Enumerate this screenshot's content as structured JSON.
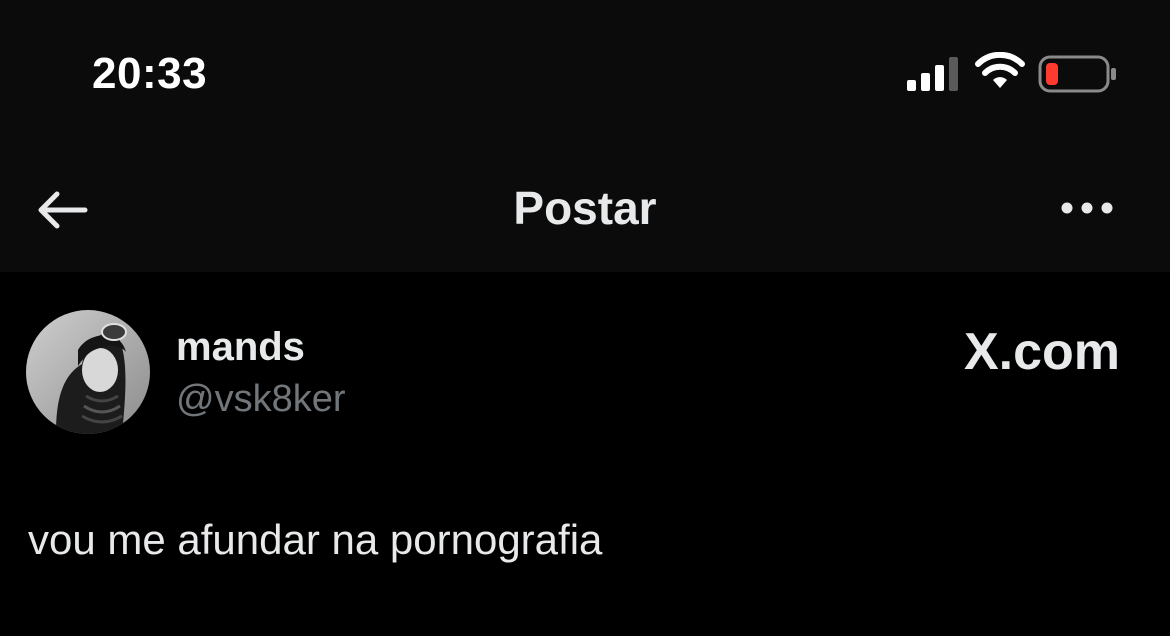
{
  "status_bar": {
    "time": "20:33",
    "icons": [
      "signal-icon",
      "wifi-icon",
      "battery-icon"
    ],
    "battery_color": "#ff3b30"
  },
  "nav": {
    "title": "Postar",
    "back_icon": "arrow-left-icon",
    "more_icon": "more-horizontal-icon"
  },
  "post": {
    "author_name": "mands",
    "author_handle": "@vsk8ker",
    "brand": "X.com",
    "text": "vou me afundar na pornografia"
  },
  "colors": {
    "background": "#000000",
    "header_background": "#0b0b0b",
    "primary_text": "#e7e9ea",
    "secondary_text": "#71767b"
  }
}
